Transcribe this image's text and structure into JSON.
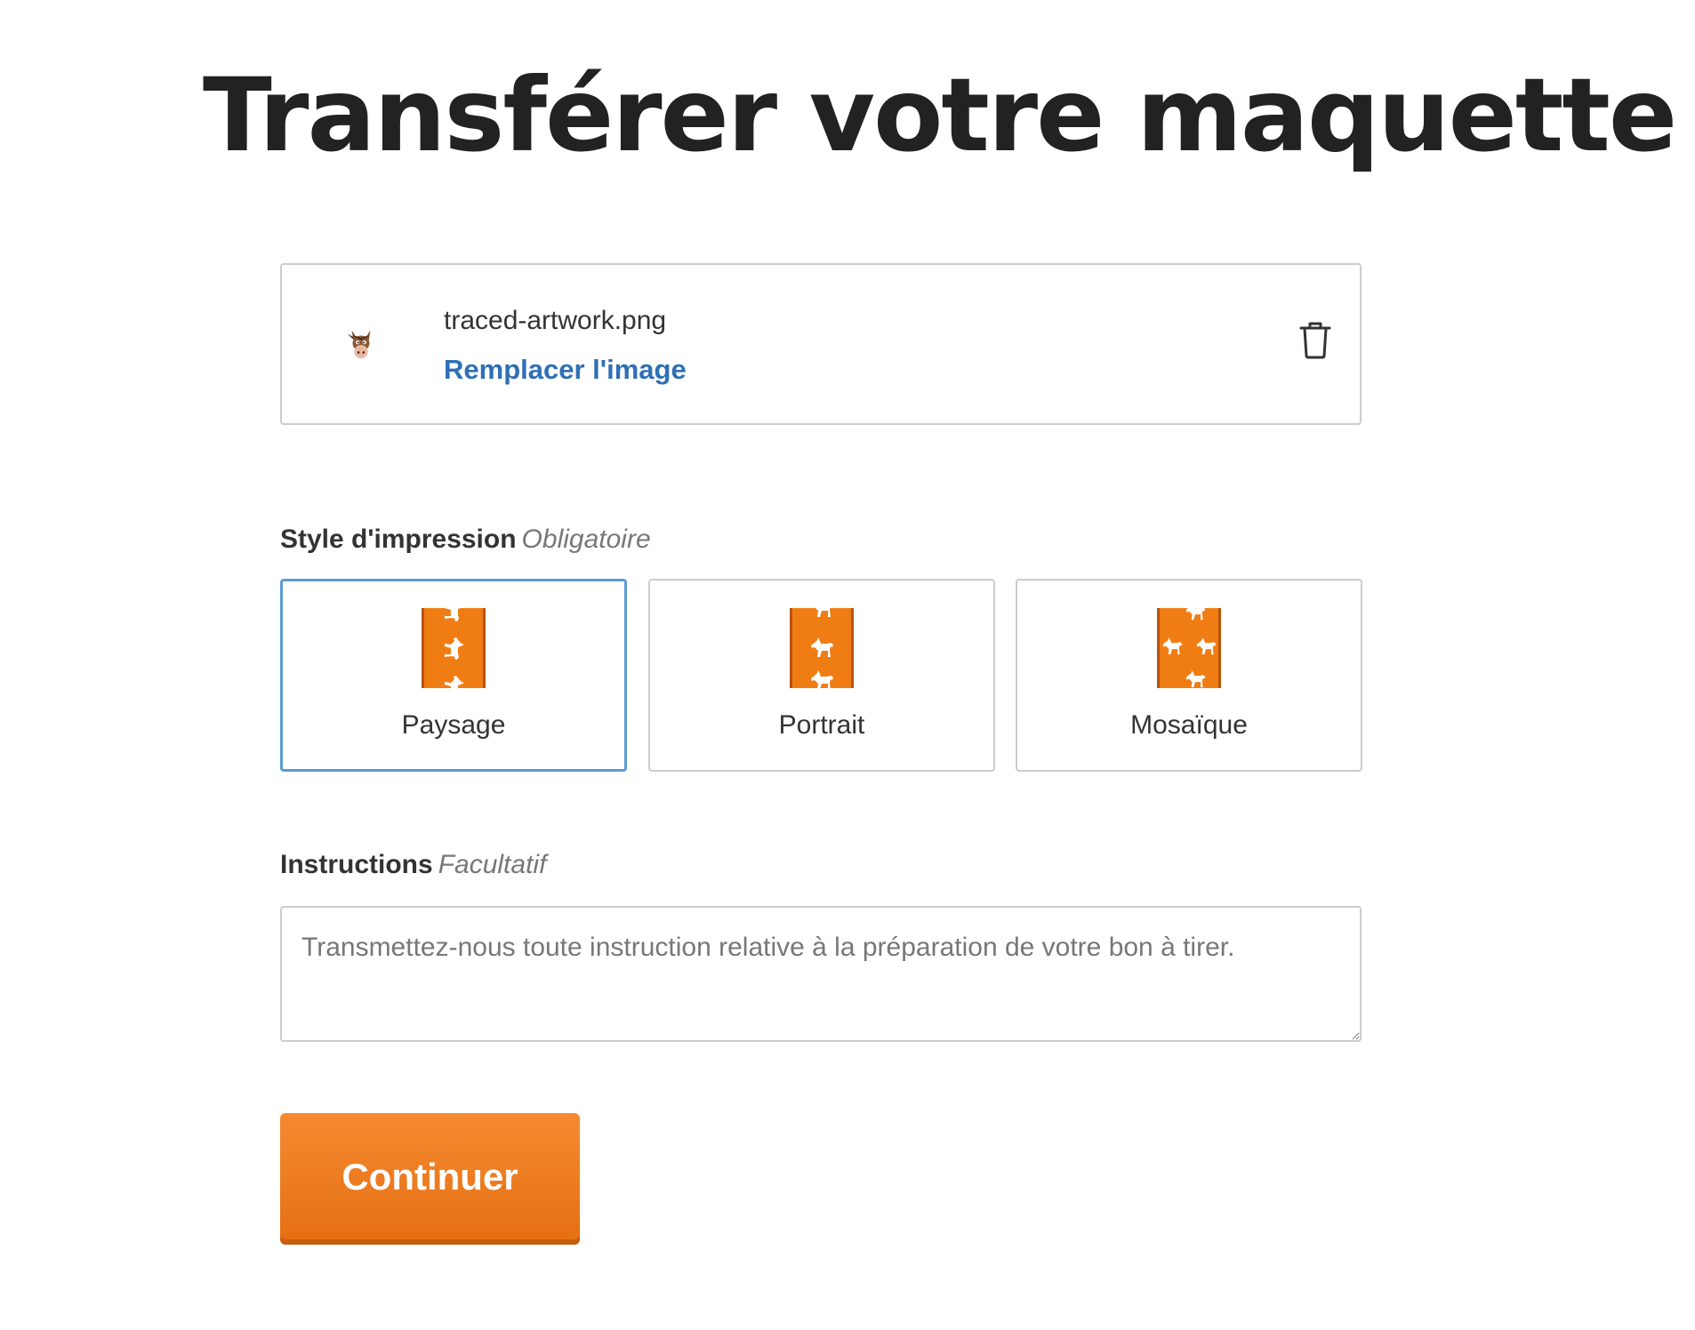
{
  "page": {
    "title": "Transférer votre maquette"
  },
  "upload": {
    "file_name": "traced-artwork.png",
    "replace_label": "Remplacer l'image",
    "thumbnail_icon": "donkey-head-icon",
    "delete_icon": "trash-icon"
  },
  "print_style": {
    "label": "Style d'impression",
    "hint": "Obligatoire",
    "selected": "Paysage",
    "options": [
      {
        "label": "Paysage",
        "icon": "horse-pattern-landscape-icon"
      },
      {
        "label": "Portrait",
        "icon": "horse-pattern-portrait-icon"
      },
      {
        "label": "Mosaïque",
        "icon": "horse-pattern-tile-icon"
      }
    ]
  },
  "instructions": {
    "label": "Instructions",
    "hint": "Facultatif",
    "value": "",
    "placeholder": "Transmettez-nous toute instruction relative à la préparation de votre bon à tirer."
  },
  "actions": {
    "continue_label": "Continuer"
  },
  "colors": {
    "accent_orange": "#e97718",
    "link_blue": "#2f6fb5",
    "selected_border": "#5b9bd5",
    "border_gray": "#cccccc",
    "text_dark": "#222222"
  }
}
